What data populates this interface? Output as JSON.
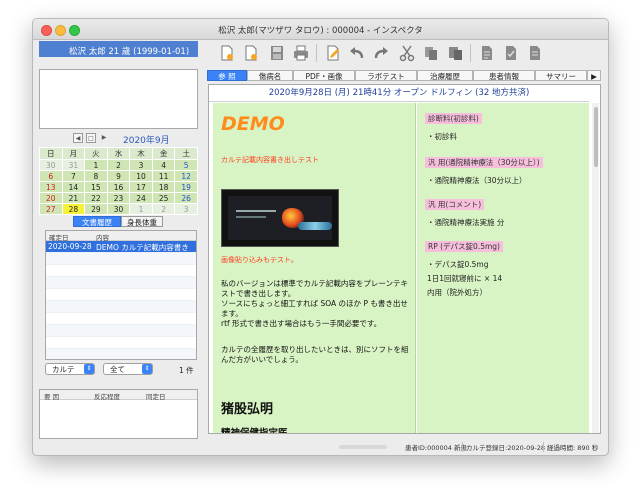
{
  "window": {
    "title": "松沢 太郎(マツザワ タロウ) : 000004 - インスペクタ"
  },
  "left": {
    "patient_header": "松沢 太郎  21 歳 (1999-01-01)",
    "calendar": {
      "title": "2020年9月",
      "weekdays": [
        "日",
        "月",
        "火",
        "水",
        "木",
        "金",
        "土"
      ],
      "rows": [
        [
          "30",
          "31",
          "1",
          "2",
          "3",
          "4",
          "5"
        ],
        [
          "6",
          "7",
          "8",
          "9",
          "10",
          "11",
          "12"
        ],
        [
          "13",
          "14",
          "15",
          "16",
          "17",
          "18",
          "19"
        ],
        [
          "20",
          "21",
          "22",
          "23",
          "24",
          "25",
          "26"
        ],
        [
          "27",
          "28",
          "29",
          "30",
          "1",
          "2",
          "3"
        ]
      ],
      "highlighted_day": "28"
    },
    "tabs": [
      "文書履歴",
      "身長体重"
    ],
    "doc_table": {
      "col_date": "確定日",
      "col_content": "内容",
      "row": {
        "date": "2020-09-28",
        "content": "DEMO  カルテ記載内容書き"
      }
    },
    "filter_type": "カルテ",
    "filter_range": "全て",
    "count": "1 件",
    "allergy": {
      "col1": "要 因",
      "col2": "反応程度",
      "col3": "同定日"
    }
  },
  "toolbar": {
    "icons": [
      "new-document-icon",
      "new-document-alt-icon",
      "save-icon",
      "print-icon",
      "edit-icon",
      "undo-icon",
      "redo-icon",
      "cut-icon",
      "copy-icon",
      "paste-icon",
      "document-icon",
      "stamp-icon",
      "document-alt-icon"
    ]
  },
  "main_tabs": [
    "参 照",
    "傷病名",
    "PDF・画像",
    "ラボテスト",
    "治療履歴",
    "患者情報",
    "サマリー",
    "▶"
  ],
  "document": {
    "header": "2020年9月28日 (月) 21時41分 オープン ドルフィン (32 地方共済)",
    "soa": {
      "demo": "DEMO",
      "red1": "カルテ記載内容書き出しテスト",
      "red2": "画像貼り込みもテスト。",
      "para1": "私のバージョンは標準でカルテ記載内容をプレーンテキストで書き出します。",
      "para2": "ソースにちょっと細工すれば SOA のほか P も書き出せます。",
      "para3": "rtf 形式で書き出す場合はもう一手間必要です。",
      "para4": "カルテの全履歴を取り出したいときは、別にソフトを組んだ方がいいでしょう。",
      "name": "猪股弘明",
      "role": "精神保健指定医"
    },
    "plan": {
      "b1": "診断料(初診料)",
      "b1i": "・初診料",
      "b2": "汎 用(通院精神療法（30分以上）)",
      "b2i": "・通院精神療法（30分以上）",
      "b3": "汎 用(コメント)",
      "b3i": "・通院精神療法実施 分",
      "b4": "RP (デパス錠0.5mg)",
      "b4i1": "・デパス錠0.5mg",
      "b4i2": "1日1回就寝前に × 14",
      "b4i3": "内用（院外処方）"
    }
  },
  "status": {
    "patient_id": "患者ID:000004 新患",
    "karte_date": "カルテ登録日:2020-09-28",
    "elapsed": "経過時間: 890 秒"
  }
}
